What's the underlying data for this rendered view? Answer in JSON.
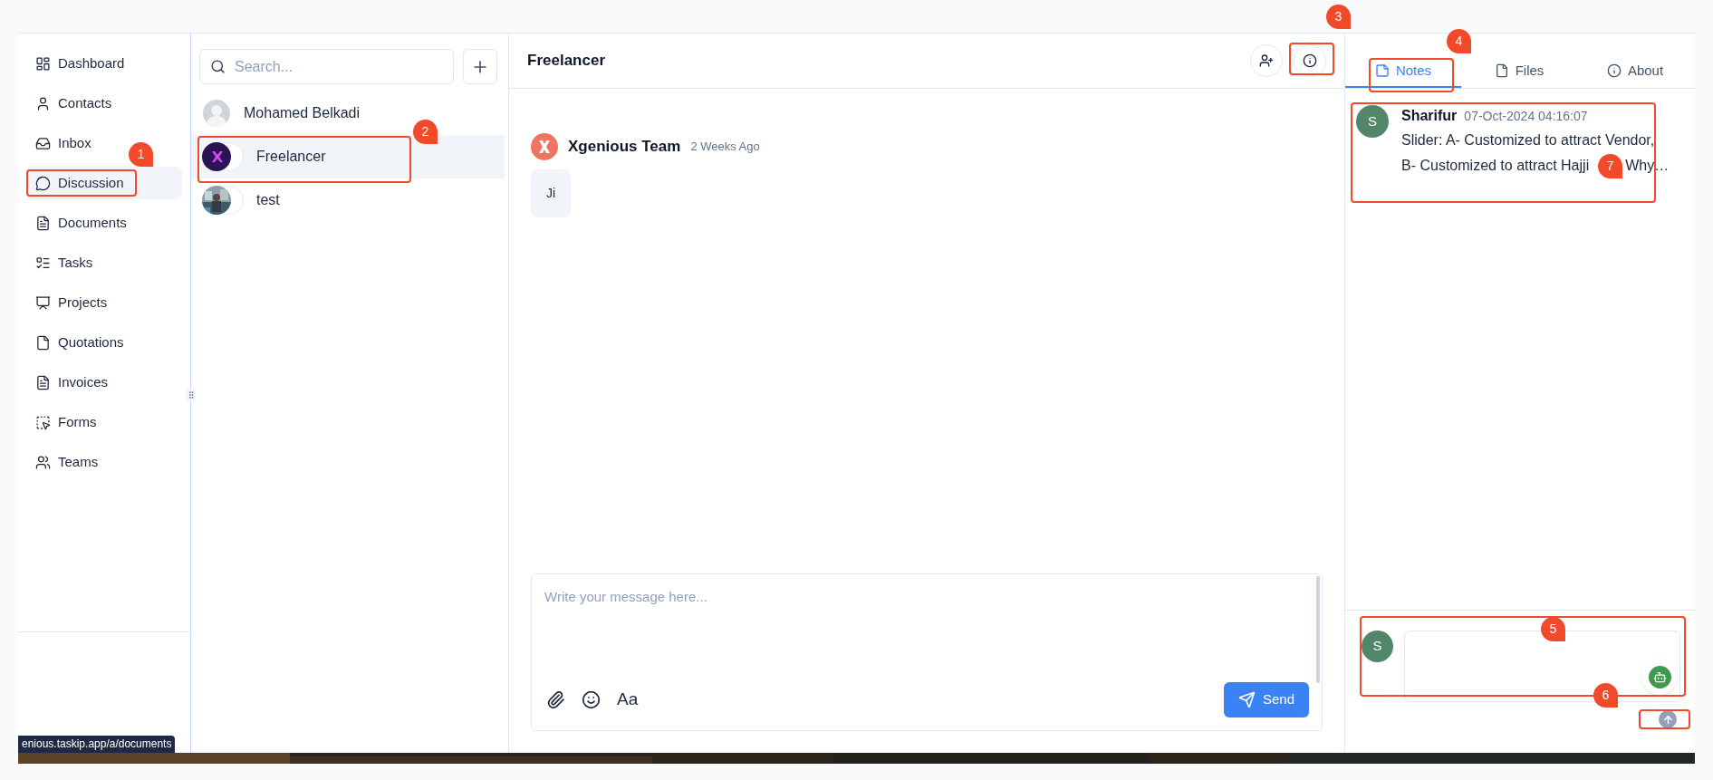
{
  "sidebar": {
    "items": [
      {
        "label": "Dashboard",
        "selected": false
      },
      {
        "label": "Contacts",
        "selected": false
      },
      {
        "label": "Inbox",
        "selected": false
      },
      {
        "label": "Discussion",
        "selected": true
      },
      {
        "label": "Documents",
        "selected": false
      },
      {
        "label": "Tasks",
        "selected": false
      },
      {
        "label": "Projects",
        "selected": false
      },
      {
        "label": "Quotations",
        "selected": false
      },
      {
        "label": "Invoices",
        "selected": false
      },
      {
        "label": "Forms",
        "selected": false
      },
      {
        "label": "Teams",
        "selected": false
      }
    ]
  },
  "status_url": "enious.taskip.app/a/documents",
  "contacts": {
    "search": {
      "placeholder": "Search..."
    },
    "items": [
      {
        "name": "Mohamed Belkadi",
        "kind": "default",
        "selected": false
      },
      {
        "name": "Freelancer",
        "kind": "logo",
        "selected": true
      },
      {
        "name": "test",
        "kind": "picture",
        "selected": false
      }
    ]
  },
  "chat": {
    "title": "Freelancer",
    "messages": [
      {
        "sender": "Xgenious Team",
        "time": "2 Weeks Ago",
        "text": "Ji"
      }
    ],
    "composer": {
      "placeholder": "Write your message here...",
      "format": "Aa",
      "send": "Send"
    }
  },
  "panel": {
    "tabs": [
      {
        "label": "Notes",
        "selected": true
      },
      {
        "label": "Files",
        "selected": false
      },
      {
        "label": "About",
        "selected": false
      }
    ],
    "notes": [
      {
        "author": "Sharifur",
        "initial": "S",
        "time": "07-Oct-2024 04:16:07",
        "lines": [
          "Slider: A- Customized to attract Vendor,",
          "B- Customized to attract Hajji"
        ],
        "tail": "Why…"
      }
    ],
    "composer": {
      "initial": "S"
    }
  },
  "annotations": [
    {
      "label": "1"
    },
    {
      "label": "2"
    },
    {
      "label": "3"
    },
    {
      "label": "4"
    },
    {
      "label": "5"
    },
    {
      "label": "6"
    },
    {
      "label": "7"
    }
  ]
}
